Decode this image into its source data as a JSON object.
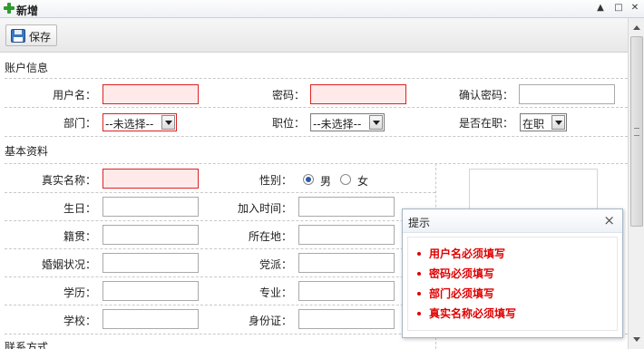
{
  "window": {
    "title": "新增",
    "controls": [
      "collapse-icon",
      "maximize-icon",
      "close-icon"
    ]
  },
  "toolbar": {
    "save_label": "保存"
  },
  "account": {
    "section_title": "账户信息",
    "username_label": "用户名：",
    "password_label": "密码：",
    "confirm_label": "确认密码：",
    "dept_label": "部门：",
    "dept_value": "--未选择--",
    "position_label": "职位：",
    "position_value": "--未选择--",
    "active_label": "是否在职：",
    "active_value": "在职"
  },
  "basic": {
    "section_title": "基本资料",
    "realname_label": "真实名称：",
    "gender_label": "性别：",
    "gender_male": "男",
    "gender_female": "女",
    "gender_selected": "男",
    "birthday_label": "生日：",
    "jointime_label": "加入时间：",
    "native_label": "籍贯：",
    "location_label": "所在地：",
    "marital_label": "婚姻状况：",
    "party_label": "党派：",
    "education_label": "学历：",
    "major_label": "专业：",
    "school_label": "学校：",
    "idcard_label": "身份证："
  },
  "next_section_partial": "联系方式",
  "tooltip": {
    "title": "提示",
    "messages": [
      "用户名必须填写",
      "密码必须填写",
      "部门必须填写",
      "真实名称必须填写"
    ]
  },
  "colors": {
    "required_border": "#dd2222",
    "required_bg": "#ffe9e9",
    "error_text": "#e00000"
  }
}
